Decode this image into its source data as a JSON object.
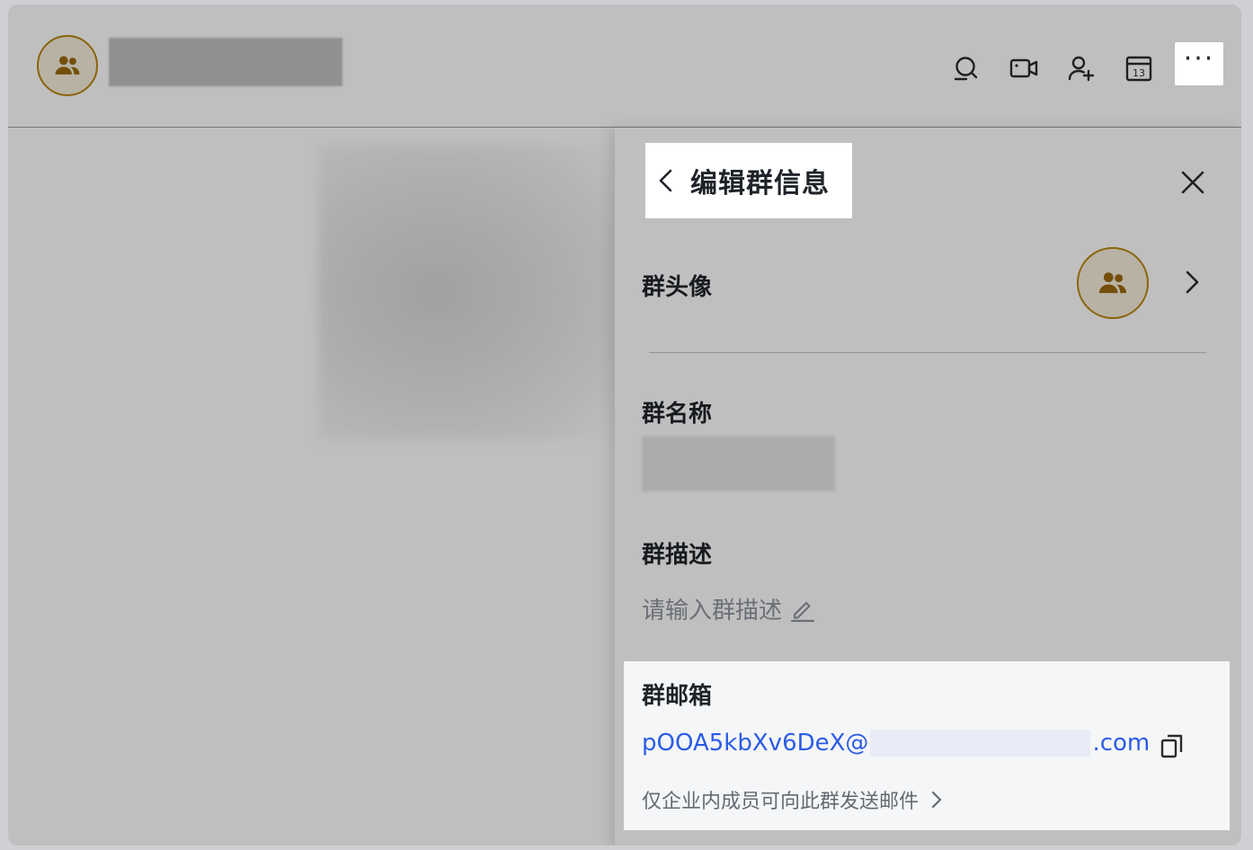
{
  "panel": {
    "title": "编辑群信息",
    "avatar_label": "群头像",
    "name_label": "群名称",
    "description_label": "群描述",
    "description_placeholder": "请输入群描述",
    "email_label": "群邮箱",
    "email_prefix": "pOOA5kbXv6DeX@",
    "email_suffix": ".com",
    "email_hint": "仅企业内成员可向此群发送邮件"
  },
  "header": {
    "more_label": "···"
  },
  "icons": {
    "avatar": "group-icon",
    "search": "search-icon",
    "video": "video-call-icon",
    "add_member": "add-member-icon",
    "calendar": "calendar-icon",
    "calendar_day": "13",
    "more": "more-icon",
    "back": "chevron-left-icon",
    "close": "close-icon",
    "edit": "edit-icon",
    "copy": "copy-icon"
  },
  "colors": {
    "accent_gold": "#b8860b",
    "link_blue": "#2b5ce6"
  }
}
